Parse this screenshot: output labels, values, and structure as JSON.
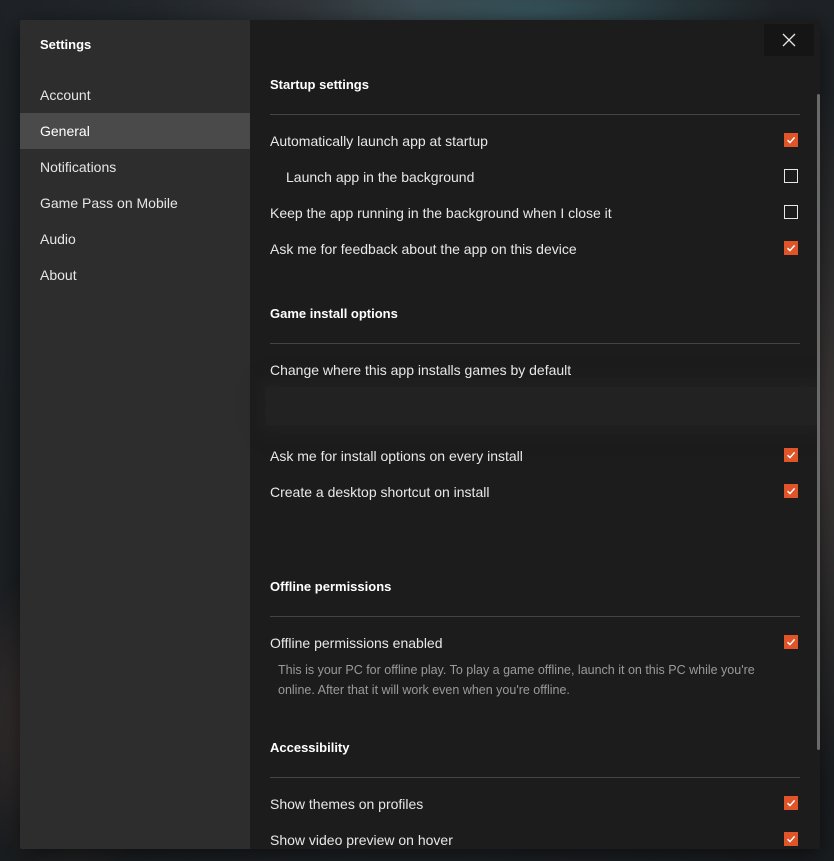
{
  "window": {
    "title": "Settings"
  },
  "sidebar": {
    "items": [
      {
        "label": "Account"
      },
      {
        "label": "General"
      },
      {
        "label": "Notifications"
      },
      {
        "label": "Game Pass on Mobile"
      },
      {
        "label": "Audio"
      },
      {
        "label": "About"
      }
    ],
    "active": "General"
  },
  "colors": {
    "accent": "#e0542a",
    "sidebar_bg": "#2d2d2d",
    "content_bg": "#1c1c1c",
    "active_item_bg": "#4a4a4a"
  },
  "sections": {
    "startup": {
      "title": "Startup settings",
      "options": [
        {
          "label": "Automatically launch app at startup",
          "checked": true
        },
        {
          "label": "Launch app in the background",
          "checked": false
        },
        {
          "label": "Keep the app running in the background when I close it",
          "checked": false
        },
        {
          "label": "Ask me for feedback about the app on this device",
          "checked": true
        }
      ]
    },
    "install": {
      "title": "Game install options",
      "location_label": "Change where this app installs games by default",
      "options": [
        {
          "label": "Ask me for install options on every install",
          "checked": true
        },
        {
          "label": "Create a desktop shortcut on install",
          "checked": true
        }
      ]
    },
    "offline": {
      "title": "Offline permissions",
      "options": [
        {
          "label": "Offline permissions enabled",
          "checked": true
        }
      ],
      "description_line1": "This is your PC for offline play. To play a game offline, launch it on this PC while you're",
      "description_line2": "online. After that it will work even when you're offline."
    },
    "accessibility": {
      "title": "Accessibility",
      "options": [
        {
          "label": "Show themes on profiles",
          "checked": true
        },
        {
          "label": "Show video preview on hover",
          "checked": true
        }
      ]
    }
  },
  "icons": {
    "close": "close-icon",
    "check": "checkmark-icon"
  }
}
